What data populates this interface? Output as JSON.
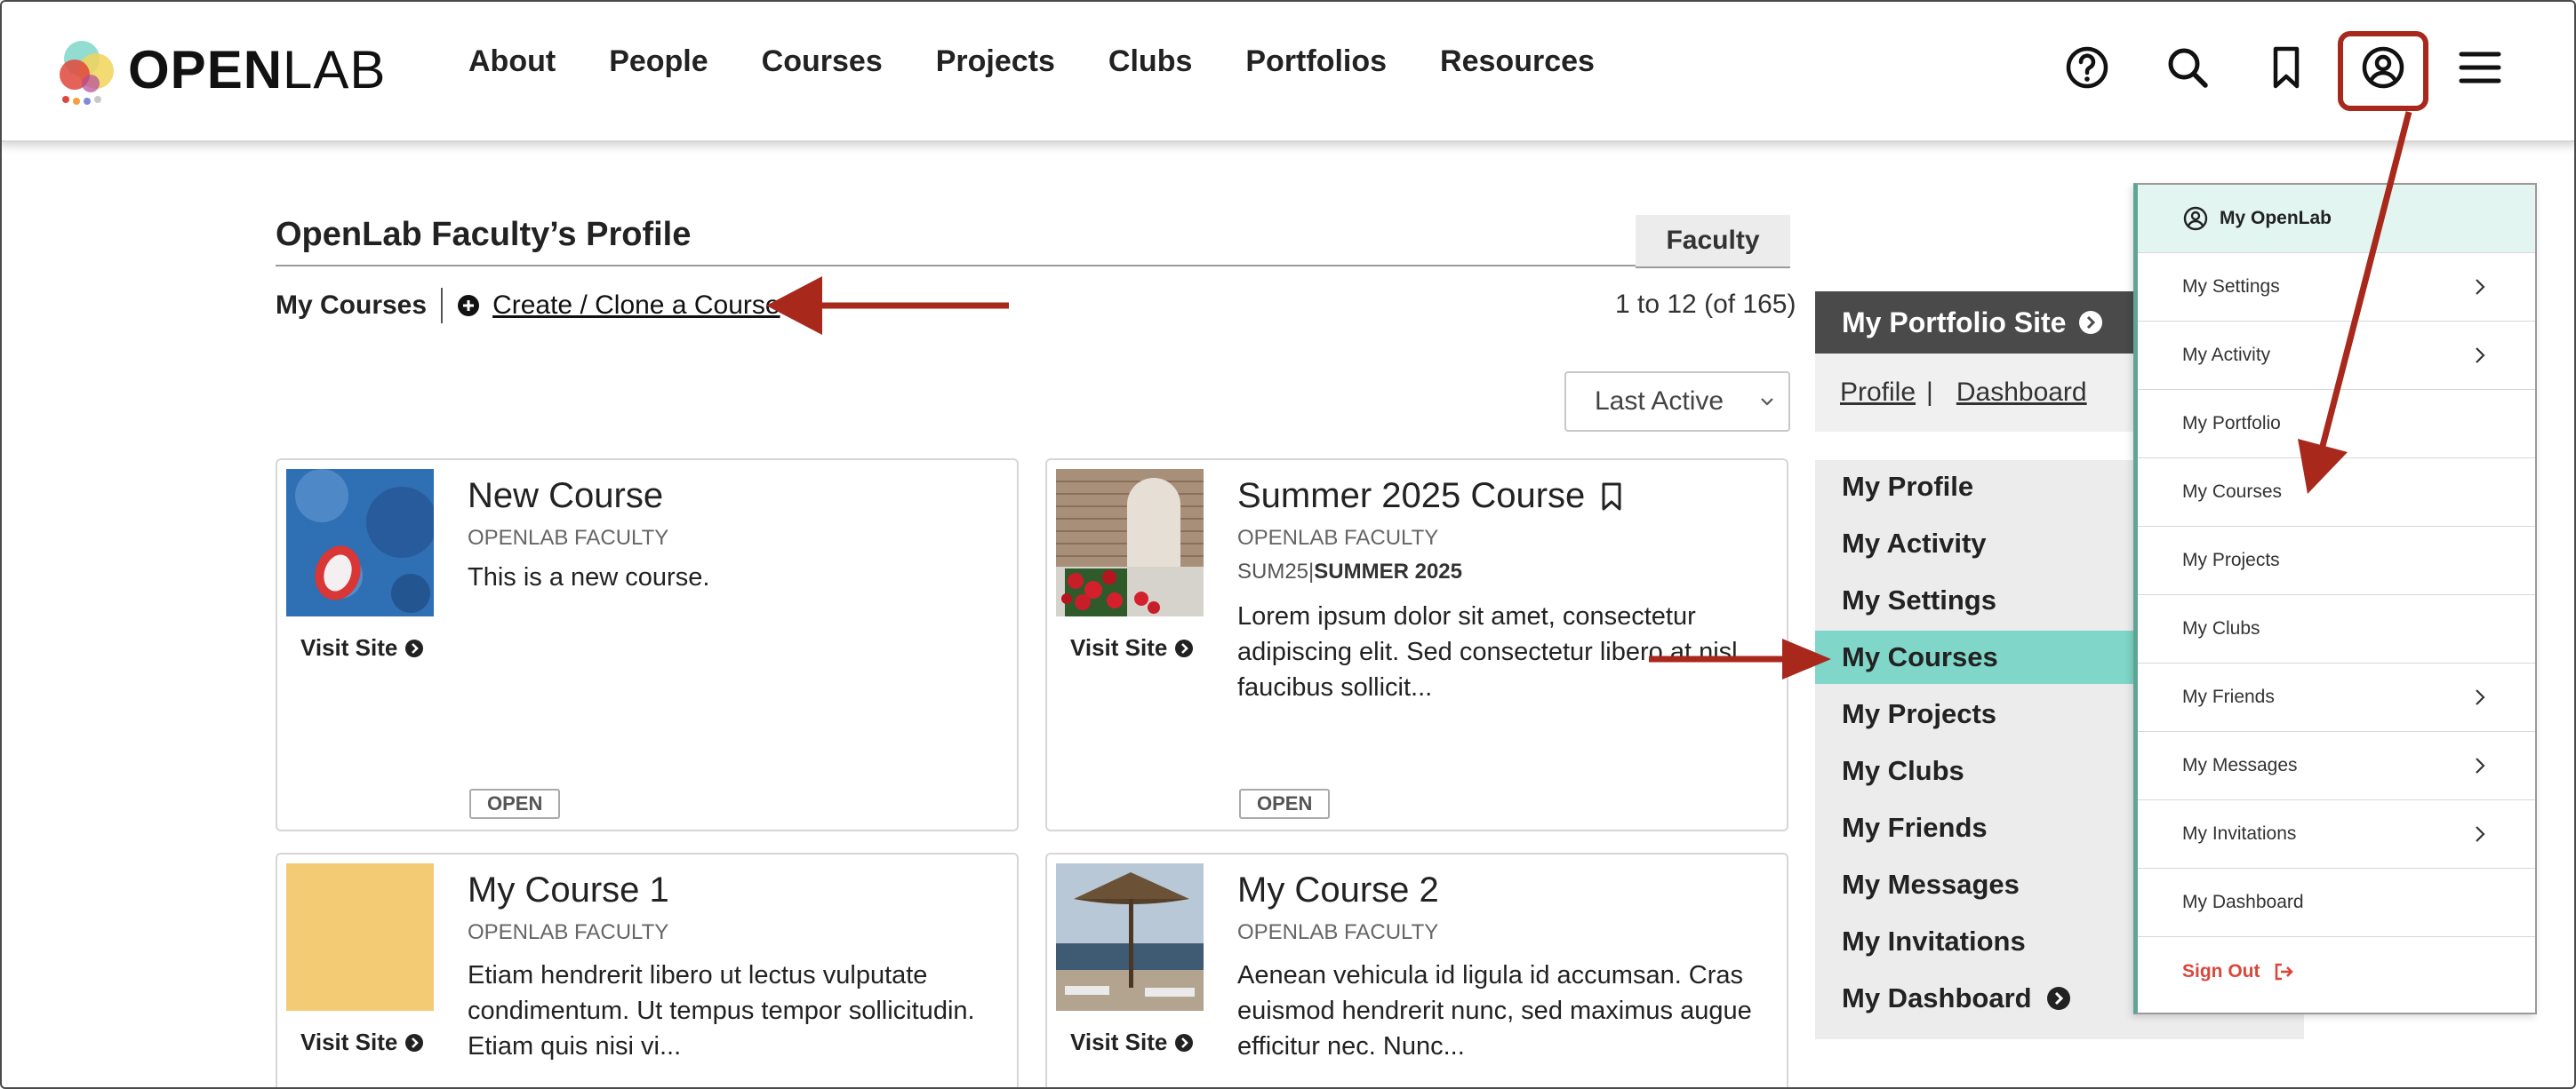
{
  "brand": {
    "wordmark_bold": "OPEN",
    "wordmark_light": "LAB"
  },
  "nav": [
    "About",
    "People",
    "Courses",
    "Projects",
    "Clubs",
    "Portfolios",
    "Resources"
  ],
  "header_icons": [
    "help-icon",
    "search-icon",
    "bookmark-icon",
    "user-circle-icon",
    "hamburger-menu-icon"
  ],
  "profile": {
    "title": "OpenLab Faculty’s Profile",
    "role_tab": "Faculty",
    "section_label": "My Courses",
    "create_link": "Create / Clone a Course",
    "count": "1 to 12 (of 165)",
    "sort_selected": "Last Active"
  },
  "courses": [
    {
      "title": "New Course",
      "faculty": "OPENLAB FACULTY",
      "semester_code": "",
      "semester_name": "",
      "description": "This is a new course.",
      "visit": "Visit Site",
      "status": "OPEN"
    },
    {
      "title": "Summer 2025 Course",
      "faculty": "OPENLAB FACULTY",
      "semester_code": "SUM25",
      "semester_sep": "|",
      "semester_name": "SUMMER 2025",
      "description": "Lorem ipsum dolor sit amet, consectetur adipiscing elit. Sed consectetur libero at nisl faucibus sollicit...",
      "visit": "Visit Site",
      "status": "OPEN"
    },
    {
      "title": "My Course 1",
      "faculty": "OPENLAB FACULTY",
      "description": "Etiam hendrerit libero ut lectus vulputate condimentum. Ut tempus tempor sollicitudin. Etiam quis nisi vi...",
      "visit": "Visit Site"
    },
    {
      "title": "My Course 2",
      "faculty": "OPENLAB FACULTY",
      "description": "Aenean vehicula id ligula id accumsan. Cras euismod hendrerit nunc, sed maximus augue efficitur nec. Nunc...",
      "visit": "Visit Site"
    }
  ],
  "sidebar": {
    "portfolio_button": "My Portfolio Site",
    "profile_link": "Profile",
    "separator": "|",
    "dashboard_link": "Dashboard",
    "items": [
      "My Profile",
      "My Activity",
      "My Settings",
      "My Courses",
      "My Projects",
      "My Clubs",
      "My Friends",
      "My Messages",
      "My Invitations",
      "My Dashboard"
    ],
    "active_item": "My Courses"
  },
  "dropdown": {
    "header": "My OpenLab",
    "items": [
      {
        "label": "My Settings",
        "has_submenu": true
      },
      {
        "label": "My Activity",
        "has_submenu": true
      },
      {
        "label": "My Portfolio",
        "has_submenu": false
      },
      {
        "label": "My Courses",
        "has_submenu": false
      },
      {
        "label": "My Projects",
        "has_submenu": false
      },
      {
        "label": "My Clubs",
        "has_submenu": false
      },
      {
        "label": "My Friends",
        "has_submenu": true
      },
      {
        "label": "My Messages",
        "has_submenu": true
      },
      {
        "label": "My Invitations",
        "has_submenu": true
      },
      {
        "label": "My Dashboard",
        "has_submenu": false
      }
    ],
    "signout": "Sign Out"
  },
  "colors": {
    "annotation_red": "#a8281c",
    "active_teal": "#7fd6c9",
    "dropdown_header_bg": "#e2f5f1",
    "signout_red": "#d9473a",
    "portfolio_dark": "#4a4a4a"
  }
}
